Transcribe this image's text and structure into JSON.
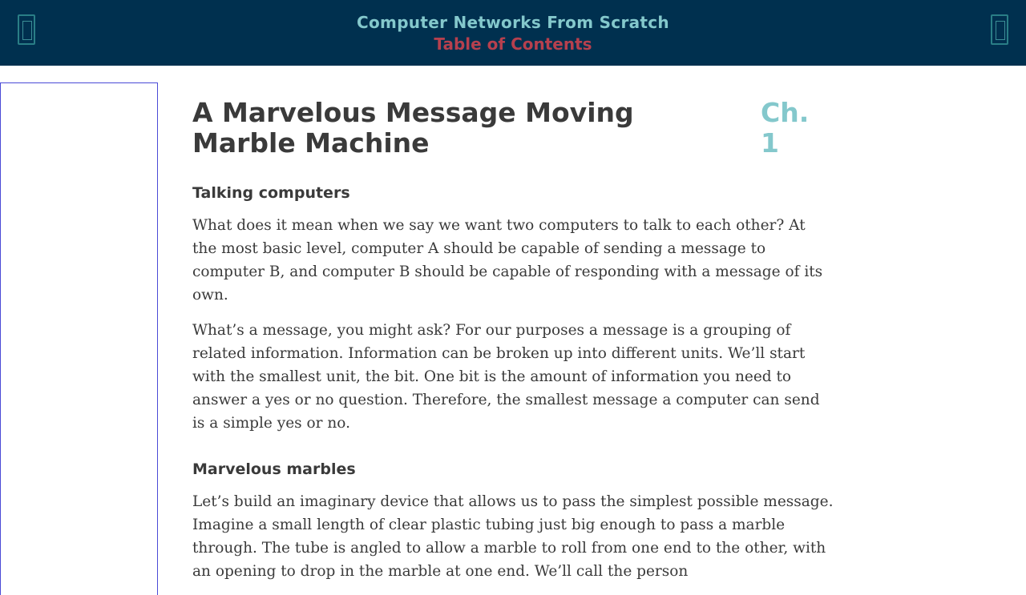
{
  "header": {
    "book_title": "Computer Networks From Scratch",
    "toc_label": "Table of Contents",
    "menu_icon": "menu-icon",
    "settings_icon": "settings-icon"
  },
  "chapter": {
    "title": "A Marvelous Message Moving Marble Machine",
    "number_label": "Ch. 1"
  },
  "sections": [
    {
      "heading": "Talking computers",
      "paragraphs": [
        "What does it mean when we say we want two computers to talk to each other? At the most basic level, computer A should be capable of sending a message to computer B, and computer B should be capable of responding with a message of its own.",
        "What’s a message, you might ask? For our purposes a message is a grouping of related information. Information can be broken up into different units. We’ll start with the smallest unit, the bit. One bit is the amount of information you need to answer a yes or no question. Therefore, the smallest message a computer can send is a simple yes or no."
      ]
    },
    {
      "heading": "Marvelous marbles",
      "paragraphs": [
        "Let’s build an imaginary device that allows us to pass the simplest possible message. Imagine a small length of clear plastic tubing just big enough to pass a marble through. The tube is angled to allow a marble to roll from one end to the other, with an opening to drop in the marble at one end. We’ll call the person"
      ]
    }
  ]
}
